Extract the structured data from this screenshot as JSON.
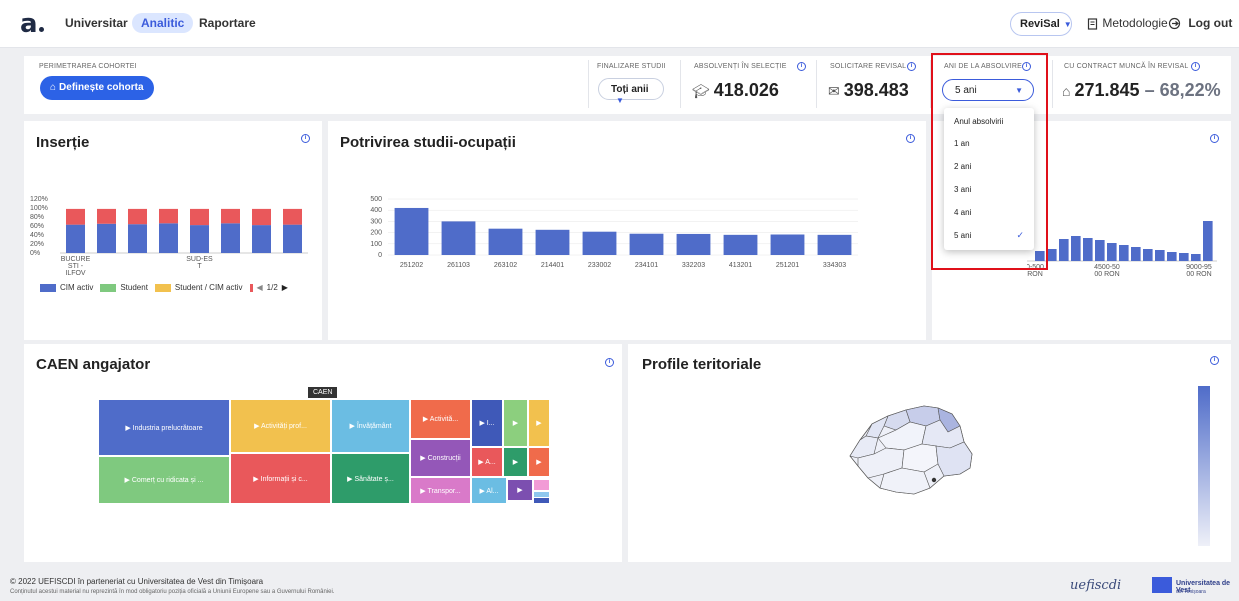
{
  "nav": {
    "logo": "a",
    "links": [
      "Universitar",
      "Analitic",
      "Raportare"
    ],
    "active": "Analitic",
    "revisal": "ReviSal",
    "metodologie": "Metodologie",
    "logout": "Log out"
  },
  "kpi": {
    "cohort_label": "PERIMETRAREA COHORTEI",
    "cohort_button": "Definește cohorta",
    "finalizare_label": "FINALIZARE STUDII",
    "finalizare_value": "Toți anii",
    "absolventi_label": "ABSOLVENȚI ÎN SELECȚIE",
    "absolventi_value": "418.026",
    "solicitare_label": "SOLICITARE REVISAL",
    "solicitare_value": "398.483",
    "ani_label": "ANI DE LA ABSOLVIRE",
    "ani_value": "5 ani",
    "contract_label": "CU CONTRACT MUNCĂ ÎN REVISAL",
    "contract_value": "271.845",
    "contract_pct": "68,22%",
    "contract_sep": "–"
  },
  "dropdown": {
    "options": [
      "Anul absolvirii",
      "1 an",
      "2 ani",
      "3 ani",
      "4 ani",
      "5 ani"
    ],
    "selected": "5 ani"
  },
  "insertie": {
    "title": "Inserție",
    "legend": [
      "CIM activ",
      "Student",
      "Student / CIM activ"
    ],
    "page": "1/2",
    "colors": {
      "cim": "#4f6cc9",
      "student": "#7fc97f",
      "student_cim": "#f2c14e",
      "other": "#e9585b"
    }
  },
  "potrivire": {
    "title": "Potrivirea studii-ocupații"
  },
  "salary": {
    "xlabels": [
      "0-500\nRON",
      "4500-50\n00 RON",
      "9000-95\n00 RON"
    ]
  },
  "caen": {
    "title": "CAEN angajator",
    "tag": "CAEN",
    "cells": [
      "▶ Industria prelucrătoare",
      "▶ Activități prof...",
      "▶ Învățământ",
      "▶ Activită...",
      "▶ I...",
      "▶",
      "▶",
      "▶ Comerț cu ridicata și ...",
      "▶ Informații și c...",
      "▶ Sănătate ș...",
      "▶ Construcții",
      "▶ A...",
      "▶",
      "▶",
      "▶ Transpor...",
      "▶ Al...",
      "▶"
    ]
  },
  "profile": {
    "title": "Profile teritoriale"
  },
  "footer": {
    "line1": "© 2022 UEFISCDI în parteneriat cu Universitatea de Vest din Timișoara",
    "line2": "Conținutul acestui material nu reprezintă în mod obligatoriu poziția oficială a Uniunii Europene sau a Guvernului României.",
    "uefiscdi": "uefiscdi",
    "uvt": "Universitatea de Vest",
    "uvt_sub": "din Timișoara"
  },
  "chart_data": [
    {
      "type": "bar",
      "stacked": true,
      "categories": [
        "BUCURESTI - ILFOV",
        "",
        "",
        "",
        "SUD-EST",
        "",
        "",
        ""
      ],
      "ylim": [
        0,
        120
      ],
      "yticks": [
        "0%",
        "20%",
        "40%",
        "60%",
        "80%",
        "100%",
        "120%"
      ],
      "xticklabels": [
        "BUCURE\nSTI -\nILFOV",
        "SUD-ES\nT"
      ],
      "series": [
        {
          "name": "CIM activ",
          "values": [
            63,
            65,
            64,
            66,
            62,
            66,
            62,
            63
          ]
        },
        {
          "name": "",
          "values": [
            35,
            33,
            34,
            32,
            36,
            32,
            36,
            35
          ]
        }
      ]
    },
    {
      "type": "bar",
      "categories": [
        "251202",
        "261103",
        "263102",
        "214401",
        "233002",
        "234101",
        "332203",
        "413201",
        "251201",
        "334303"
      ],
      "values": [
        420,
        300,
        235,
        225,
        208,
        190,
        188,
        180,
        183,
        180
      ],
      "ylim": [
        0,
        500
      ],
      "yticks": [
        0,
        100,
        200,
        300,
        400,
        500
      ]
    },
    {
      "type": "bar",
      "categories": [
        "0-500 RON",
        "4500-5000 RON",
        "9000-9500 RON"
      ],
      "values": [
        10,
        12,
        22,
        25,
        23,
        21,
        18,
        16,
        14,
        12,
        11,
        9,
        8,
        7,
        40
      ],
      "note_values": "relative bar heights"
    }
  ]
}
